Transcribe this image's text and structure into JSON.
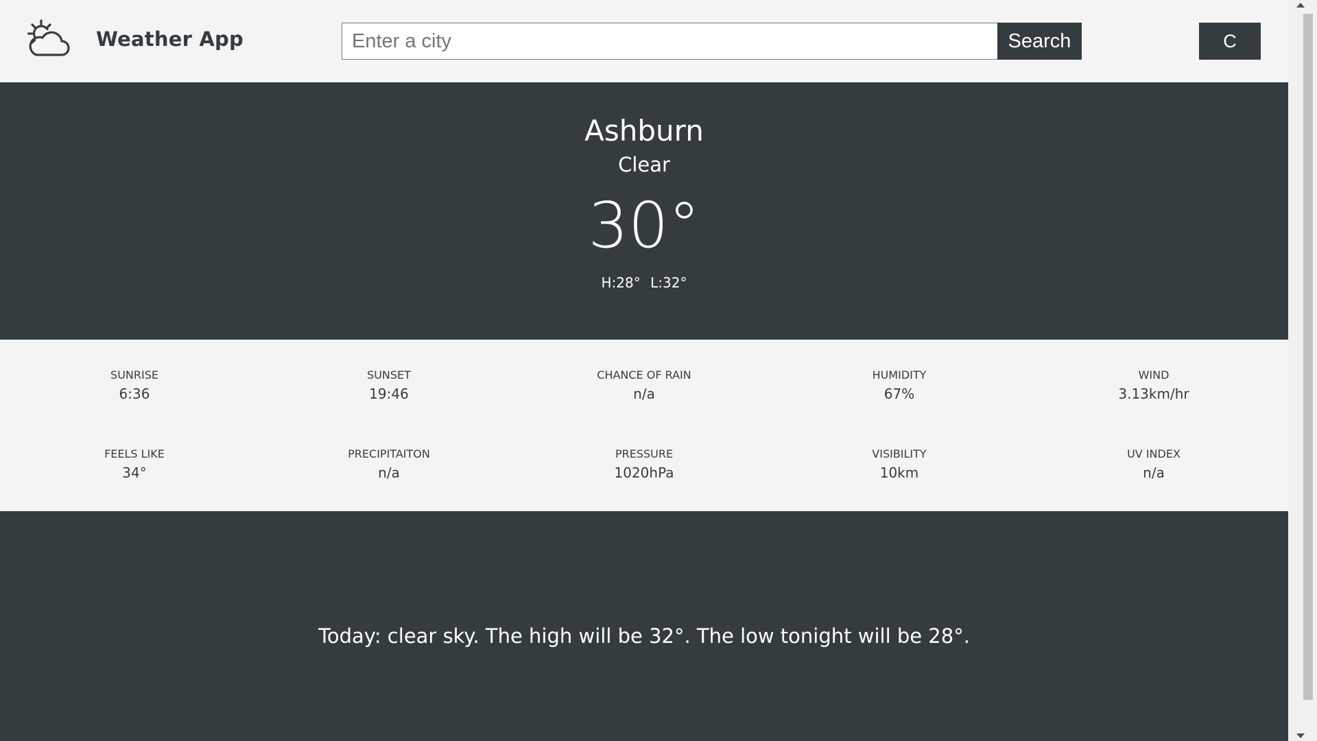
{
  "header": {
    "logo_icon": "partly-cloudy-icon",
    "title": "Weather App",
    "search_placeholder": "Enter a city",
    "search_value": "",
    "search_label": "Search",
    "unit_label": "C"
  },
  "current": {
    "city": "Ashburn",
    "condition": "Clear",
    "temperature": "30°",
    "high": "H:28°",
    "low": "L:32°"
  },
  "details": [
    {
      "label": "SUNRISE",
      "value": "6:36"
    },
    {
      "label": "SUNSET",
      "value": "19:46"
    },
    {
      "label": "CHANCE OF RAIN",
      "value": "n/a"
    },
    {
      "label": "HUMIDITY",
      "value": "67%"
    },
    {
      "label": "WIND",
      "value": "3.13km/hr"
    },
    {
      "label": "FEELS LIKE",
      "value": "34°"
    },
    {
      "label": "PRECIPITAITON",
      "value": "n/a"
    },
    {
      "label": "PRESSURE",
      "value": "1020hPa"
    },
    {
      "label": "VISIBILITY",
      "value": "10km"
    },
    {
      "label": "UV INDEX",
      "value": "n/a"
    }
  ],
  "summary": {
    "text": "Today: clear sky. The high will be 32°. The low tonight will be 28°."
  },
  "colors": {
    "dark": "#353c40",
    "light": "#f4f4f4",
    "text_on_dark": "#ffffff"
  }
}
